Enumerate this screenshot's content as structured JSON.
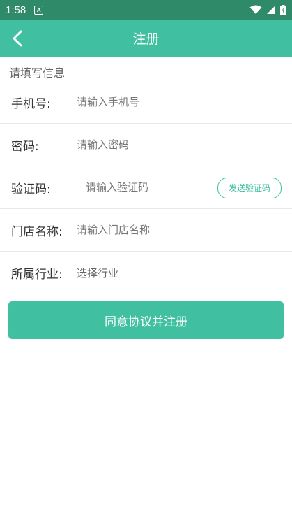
{
  "status_bar": {
    "time": "1:58",
    "notification_letter": "A",
    "icons": [
      "wifi-icon",
      "signal-icon",
      "battery-charging-icon"
    ]
  },
  "header": {
    "title": "注册",
    "back_icon": "chevron-left-icon",
    "color": "#40c0a0"
  },
  "form": {
    "section_title": "请填写信息",
    "phone": {
      "label": "手机号:",
      "placeholder": "请输入手机号"
    },
    "password": {
      "label": "密码:",
      "placeholder": "请输入密码"
    },
    "code": {
      "label": "验证码:",
      "placeholder": "请输入验证码",
      "send_button": "发送验证码"
    },
    "store": {
      "label": "门店名称:",
      "placeholder": "请输入门店名称"
    },
    "industry": {
      "label": "所属行业:",
      "placeholder": "选择行业"
    },
    "submit_label": "同意协议并注册"
  },
  "colors": {
    "accent": "#40c0a0",
    "status_bar": "#2e8a68"
  }
}
